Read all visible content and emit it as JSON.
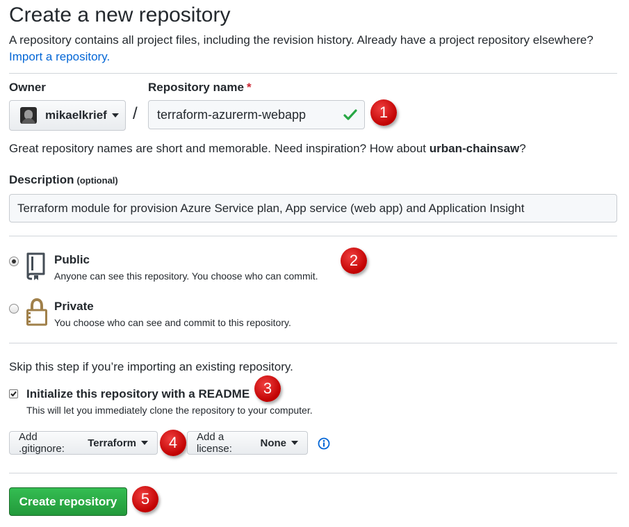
{
  "page": {
    "title": "Create a new repository",
    "subtitle": "A repository contains all project files, including the revision history. Already have a project repository elsewhere?",
    "import_link": "Import a repository."
  },
  "owner": {
    "label": "Owner",
    "value": "mikaelkrief"
  },
  "repo_name": {
    "label": "Repository name",
    "required_mark": "*",
    "slash": "/",
    "value": "terraform-azurerm-webapp",
    "valid": true
  },
  "hint": {
    "text": "Great repository names are short and memorable. Need inspiration? How about ",
    "suggestion": "urban-chainsaw",
    "end": "?"
  },
  "description": {
    "label": "Description",
    "optional": "(optional)",
    "value": "Terraform module for provision Azure Service plan, App service (web app) and Application Insight"
  },
  "visibility": {
    "selected": "public",
    "public": {
      "title": "Public",
      "desc": "Anyone can see this repository. You choose who can commit.",
      "icon": "repo-book-icon"
    },
    "private": {
      "title": "Private",
      "desc": "You choose who can see and commit to this repository.",
      "icon": "lock-icon"
    }
  },
  "init": {
    "skip_text": "Skip this step if you’re importing an existing repository.",
    "readme_label": "Initialize this repository with a README",
    "readme_desc": "This will let you immediately clone the repository to your computer.",
    "readme_checked": true
  },
  "gitignore": {
    "prefix": "Add .gitignore:",
    "value": "Terraform"
  },
  "license": {
    "prefix": "Add a license:",
    "value": "None"
  },
  "submit": {
    "label": "Create repository"
  },
  "annotations": [
    "1",
    "2",
    "3",
    "4",
    "5"
  ],
  "colors": {
    "link": "#0366d6",
    "primary_button": "#28a745",
    "badge": "#d40000",
    "check": "#28a745"
  }
}
